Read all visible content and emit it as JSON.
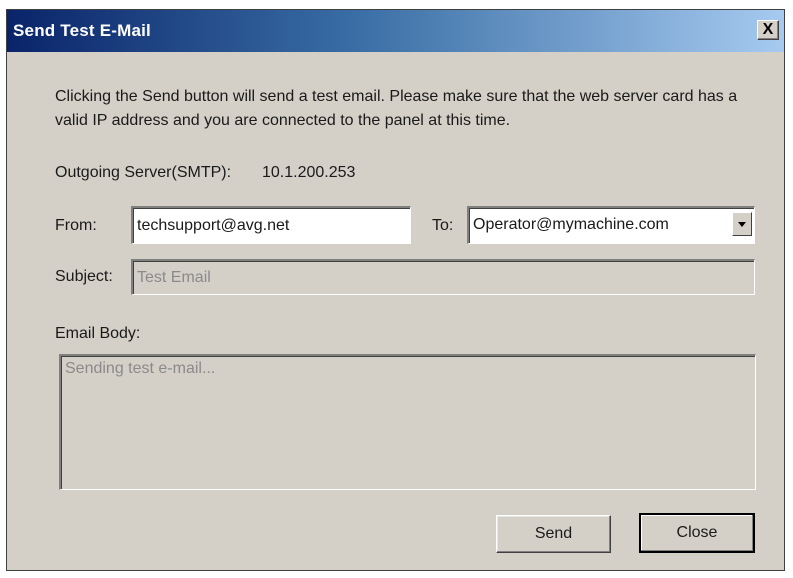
{
  "window": {
    "title": "Send Test E-Mail",
    "close_glyph": "X"
  },
  "description": "Clicking the Send button will send a test email. Please make sure that the web server card has a valid IP address and you are connected to the panel at this time.",
  "smtp": {
    "label": "Outgoing Server(SMTP):",
    "value": "10.1.200.253"
  },
  "from": {
    "label": "From:",
    "value": "techsupport@avg.net"
  },
  "to": {
    "label": "To:",
    "value": "Operator@mymachine.com"
  },
  "subject": {
    "label": "Subject:",
    "value": "Test Email"
  },
  "body": {
    "label": "Email Body:",
    "value": "Sending test e-mail..."
  },
  "buttons": {
    "send": "Send",
    "close": "Close"
  },
  "icons": {
    "close": "close-icon",
    "dropdown": "chevron-down-icon"
  }
}
